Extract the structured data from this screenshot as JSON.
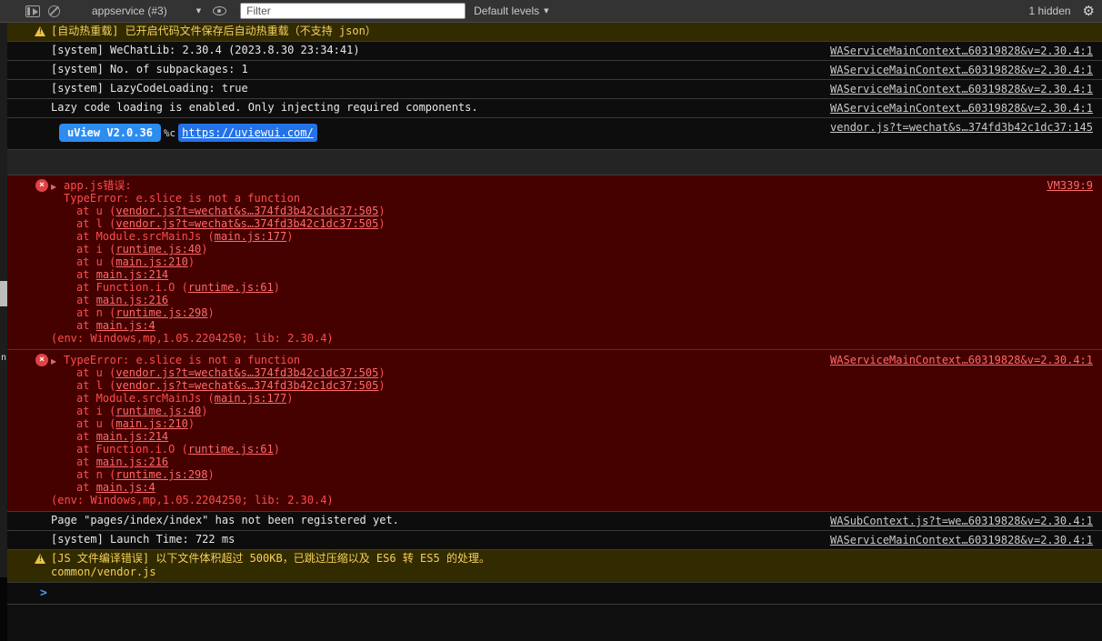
{
  "icons": {
    "settings_gear": "⚙",
    "dropdown_caret": "▼",
    "expand_triangle": "▶",
    "error_cross": "×",
    "warning_bang": "!",
    "prompt_chevron": ">"
  },
  "colors": {
    "accent_blue": "#2d8cf0",
    "error_bg": "#450000",
    "error_text": "#ff4d4d",
    "warning_bg": "#332b00",
    "warning_text": "#f2d05e",
    "link_gray": "#c9c9c9"
  },
  "left_strip": {
    "fragment": "n"
  },
  "toolbar": {
    "context_label": "appservice (#3)",
    "filter_placeholder": "Filter",
    "levels_label": "Default levels",
    "hidden_label": "1 hidden"
  },
  "console": {
    "prompt": ">",
    "messages": [
      {
        "kind": "warn",
        "text": "[自动热重载] 已开启代码文件保存后自动热重载（不支持 json）"
      },
      {
        "kind": "log",
        "text": "[system] WeChatLib: 2.30.4 (2023.8.30 23:34:41)",
        "source": "WAServiceMainContext…60319828&v=2.30.4:1"
      },
      {
        "kind": "log",
        "text": "[system] No. of subpackages: 1",
        "source": "WAServiceMainContext…60319828&v=2.30.4:1"
      },
      {
        "kind": "log",
        "text": "[system] LazyCodeLoading: true",
        "source": "WAServiceMainContext…60319828&v=2.30.4:1"
      },
      {
        "kind": "log",
        "text": "Lazy code loading is enabled. Only injecting required components.",
        "source": "WAServiceMainContext…60319828&v=2.30.4:1"
      },
      {
        "kind": "badge",
        "badge": "uView V2.0.36",
        "mid": "%c",
        "link": "https://uviewui.com/",
        "source": "vendor.js?t=wechat&s…374fd3b42c1dc37:145"
      },
      {
        "kind": "spacer"
      },
      {
        "kind": "error",
        "header": "app.js错误:",
        "subheader": "TypeError: e.slice is not a function",
        "stack": [
          {
            "pre": "at u (",
            "link": "vendor.js?t=wechat&s…374fd3b42c1dc37:505",
            "post": ")"
          },
          {
            "pre": "at l (",
            "link": "vendor.js?t=wechat&s…374fd3b42c1dc37:505",
            "post": ")"
          },
          {
            "pre": "at Module.srcMainJs (",
            "link": "main.js:177",
            "post": ")"
          },
          {
            "pre": "at i (",
            "link": "runtime.js:40",
            "post": ")"
          },
          {
            "pre": "at u (",
            "link": "main.js:210",
            "post": ")"
          },
          {
            "pre": "at ",
            "link": "main.js:214",
            "post": ""
          },
          {
            "pre": "at Function.i.O (",
            "link": "runtime.js:61",
            "post": ")"
          },
          {
            "pre": "at ",
            "link": "main.js:216",
            "post": ""
          },
          {
            "pre": "at n (",
            "link": "runtime.js:298",
            "post": ")"
          },
          {
            "pre": "at ",
            "link": "main.js:4",
            "post": ""
          }
        ],
        "env": "(env: Windows,mp,1.05.2204250; lib: 2.30.4)",
        "source": "VM339:9"
      },
      {
        "kind": "error",
        "header": "TypeError: e.slice is not a function",
        "stack": [
          {
            "pre": "at u (",
            "link": "vendor.js?t=wechat&s…374fd3b42c1dc37:505",
            "post": ")"
          },
          {
            "pre": "at l (",
            "link": "vendor.js?t=wechat&s…374fd3b42c1dc37:505",
            "post": ")"
          },
          {
            "pre": "at Module.srcMainJs (",
            "link": "main.js:177",
            "post": ")"
          },
          {
            "pre": "at i (",
            "link": "runtime.js:40",
            "post": ")"
          },
          {
            "pre": "at u (",
            "link": "main.js:210",
            "post": ")"
          },
          {
            "pre": "at ",
            "link": "main.js:214",
            "post": ""
          },
          {
            "pre": "at Function.i.O (",
            "link": "runtime.js:61",
            "post": ")"
          },
          {
            "pre": "at ",
            "link": "main.js:216",
            "post": ""
          },
          {
            "pre": "at n (",
            "link": "runtime.js:298",
            "post": ")"
          },
          {
            "pre": "at ",
            "link": "main.js:4",
            "post": ""
          }
        ],
        "env": "(env: Windows,mp,1.05.2204250; lib: 2.30.4)",
        "source": "WAServiceMainContext…60319828&v=2.30.4:1"
      },
      {
        "kind": "log",
        "text": "Page \"pages/index/index\" has not been registered yet.",
        "source": "WASubContext.js?t=we…60319828&v=2.30.4:1"
      },
      {
        "kind": "log",
        "text": "[system] Launch Time: 722 ms",
        "source": "WAServiceMainContext…60319828&v=2.30.4:1"
      },
      {
        "kind": "warn",
        "text": "[JS 文件编译错误] 以下文件体积超过 500KB，已跳过压缩以及 ES6 转 ES5 的处理。",
        "text2": "common/vendor.js"
      }
    ]
  }
}
